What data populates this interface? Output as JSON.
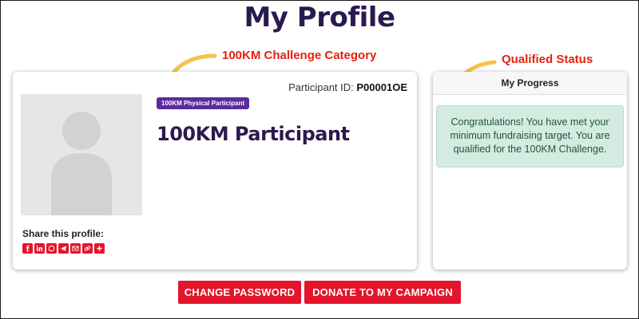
{
  "page": {
    "title": "My Profile"
  },
  "annotations": {
    "category": "100KM Challenge Category",
    "status": "Qualified Status",
    "arrow_color": "#f5c24a",
    "text_color": "#e8200f"
  },
  "profile": {
    "participant_id_label": "Participant ID:",
    "participant_id": "P00001OE",
    "badge": "100KM Physical Participant",
    "title": "100KM Participant",
    "share_label": "Share this profile:",
    "share_icons": [
      "facebook-icon",
      "linkedin-icon",
      "whatsapp-icon",
      "telegram-icon",
      "email-icon",
      "copy-link-icon",
      "more-share-icon"
    ]
  },
  "progress": {
    "header": "My Progress",
    "message": "Congratulations! You have met your minimum fundraising target. You are qualified for the 100KM Challenge."
  },
  "buttons": {
    "change_password": "CHANGE PASSWORD",
    "donate": "DONATE TO MY CAMPAIGN"
  },
  "colors": {
    "brand_red": "#e3152b",
    "badge_purple": "#5a2b9e",
    "title_navy": "#2b1a4e",
    "success_bg": "#d3ebe0"
  }
}
